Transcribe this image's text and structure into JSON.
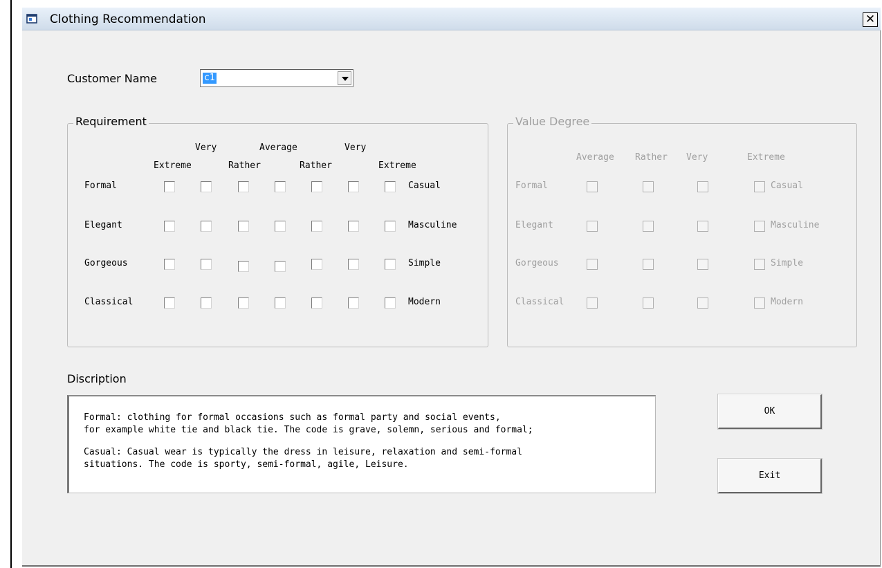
{
  "window": {
    "title": "Clothing Recommendation",
    "close_glyph": "✕"
  },
  "customer": {
    "label": "Customer Name",
    "selected": "c1"
  },
  "requirement": {
    "label": "Requirement",
    "headers_top": [
      "Very",
      "Average",
      "Very"
    ],
    "headers_bottom": [
      "Extreme",
      "Rather",
      "Rather",
      "Extreme"
    ],
    "rows": [
      {
        "left": "Formal",
        "right": "Casual"
      },
      {
        "left": "Elegant",
        "right": "Masculine"
      },
      {
        "left": "Gorgeous",
        "right": "Simple"
      },
      {
        "left": "Classical",
        "right": "Modern"
      }
    ]
  },
  "value_degree": {
    "label": "Value Degree",
    "headers": [
      "Average",
      "Rather",
      "Very",
      "Extreme"
    ],
    "rows": [
      {
        "left": "Formal",
        "right": "Casual"
      },
      {
        "left": "Elegant",
        "right": "Masculine"
      },
      {
        "left": "Gorgeous",
        "right": "Simple"
      },
      {
        "left": "Classical",
        "right": "Modern"
      }
    ]
  },
  "description": {
    "label": "Discription",
    "lines": [
      "Formal: clothing for formal occasions such as formal party and social events,",
      "for example white tie and black tie. The code is grave, solemn, serious and formal;",
      "Casual: Casual wear is typically the dress in leisure, relaxation and semi-formal",
      "situations. The code is sporty, semi-formal, agile, Leisure."
    ]
  },
  "buttons": {
    "ok": "OK",
    "exit": "Exit"
  },
  "icons": {
    "app": "window-app-icon",
    "close": "close-icon",
    "dropdown": "chevron-down-icon"
  }
}
